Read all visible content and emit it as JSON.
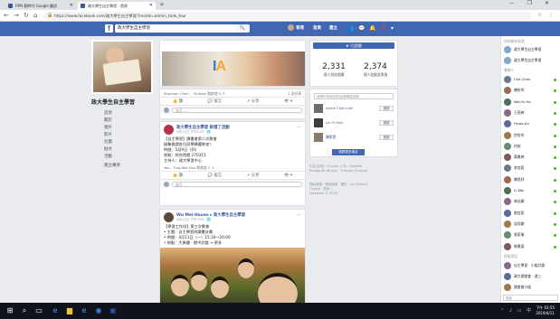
{
  "browser": {
    "tabs": [
      {
        "label": "RPN 勤時刊 Google 翻訳"
      },
      {
        "label": "政大學生自主學習 - 首頁"
      }
    ],
    "new_tab": "+",
    "window_controls": "— ❐ ✕",
    "url": "https://www.facebook.com/政大學生自主學習/?modal=admin_todo_tour"
  },
  "fb_header": {
    "logo": "f",
    "search_value": "政大學生自主學習",
    "search_icon": "🔍",
    "user_name": "育瑄",
    "home": "首頁",
    "create": "建立",
    "icons": [
      "👥",
      "💬",
      "🔔",
      "❓",
      "▾"
    ]
  },
  "left": {
    "page_name": "政大學生自主學習",
    "nav": [
      "首頁",
      "關於",
      "相片",
      "影片",
      "社團",
      "貼文",
      "活動",
      "建立專頁"
    ]
  },
  "cover": {
    "buttons": [
      "已按讚 ▾",
      "✓ 追蹤中 ▾",
      "↗ 分享 ▾",
      "..."
    ],
    "ia_text": "IA"
  },
  "pinned": {
    "reactions": "Shannon Chen 、Yu-Naai 和其他 5 人",
    "shares": "1 次分享",
    "actions": [
      "👍 讚",
      "💬 留言",
      "↗ 分享",
      "👁 ▾"
    ],
    "comment_placeholder": "留言……"
  },
  "post1": {
    "author": "政大學生自主學習 新增了活動",
    "time": "4月11日 下午4:23 · 🌐",
    "lines": [
      "【自主學習】讀書會第二次聚會",
      "誠摯邀請各位同學踴躍參加！",
      "時間：5月9日（四）",
      "地點：綜合院館 270315",
      "主持人：政大學習中心"
    ],
    "reactions": "You、Ting-Wei Hsu 和其他 2 人",
    "actions": [
      "👍 讚",
      "💬 留言",
      "↗ 分享",
      "👁 ▾"
    ],
    "comment_placeholder": "留言……"
  },
  "post2": {
    "author": "Wu Mei-Hsuan ▸ 政大學生自主學習",
    "time": "4月11日 下午3:50 · 🌐",
    "lines": [
      "【學習工作坊】第三次聚會",
      "• 主題：自主學習與讀書計畫",
      "• 時間：4月11日（一）15:30～20:00",
      "• 地點：大勇樓 · 期中討論 → 更多"
    ]
  },
  "right": {
    "like_button": "★ 已說讚",
    "likes_count": "2,331",
    "likes_label": "個人說這個讚",
    "follows_count": "2,374",
    "follows_label": "個人追蹤此專頁",
    "invite_search_placeholder": "邀請你的朋友對這個專頁按讚",
    "friends": [
      {
        "name": "Annie Chen Lee",
        "btn": "邀請"
      },
      {
        "name": "Lin Yi Hsin",
        "btn": "邀請"
      },
      {
        "name": "陳宥萱",
        "btn": "邀請"
      }
    ],
    "invite_more": "邀請更多朋友",
    "lang_line1": "中文(台灣) · English (US) · Español",
    "lang_line2": "Português (Brasil) · Français (France)",
    "links_line1": "隱私政策 · 使用條款 · 廣告 · Ad Choices",
    "links_line2": "Cookie · 更多 ›",
    "copyright": "Facebook © 2019"
  },
  "chat": {
    "sec_pages": "你的粉絲專頁",
    "pages": [
      "政大學生自主學習",
      "政大學生自主學習"
    ],
    "sec_contacts": "聯絡人",
    "contacts": [
      "Cho Chen",
      "陳怡伶",
      "Wei-Yu Ho",
      "王莉婷",
      "Hsiao-An",
      "許怡伶",
      "何宛",
      "黃雅婷",
      "李宜庭",
      "陳思妤",
      "Li Wei",
      "林佳穎",
      "劉宜庭",
      "吳欣穎",
      "張家瑜",
      "郭雅惠"
    ],
    "sec_groups": "群組對話",
    "groups": [
      "自主學習 · 小組討論",
      "政大讀書會 · 週三",
      "讀書會小組"
    ],
    "search_placeholder": "搜尋"
  },
  "taskbar": {
    "time": "下午 03:55",
    "date": "2019/4/11"
  }
}
